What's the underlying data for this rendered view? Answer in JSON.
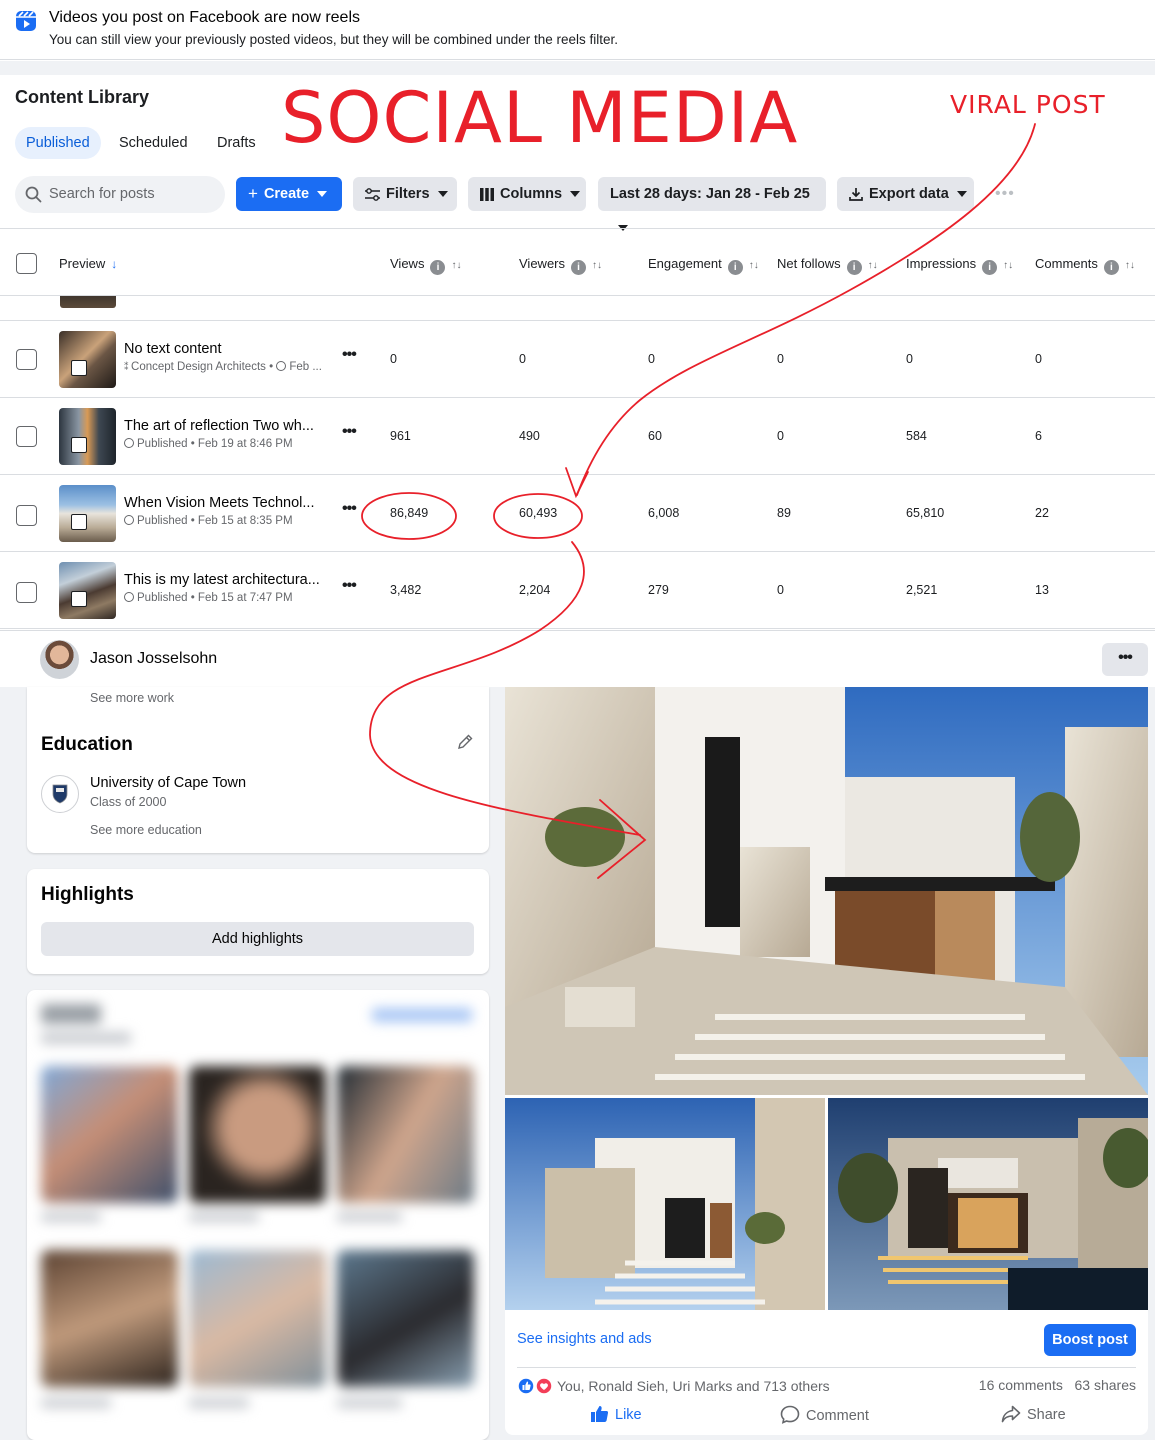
{
  "banner": {
    "title": "Videos you post on Facebook are now reels",
    "subtitle": "You can still view your previously posted videos, but they will be combined under the reels filter.",
    "icon": "reels-icon"
  },
  "library": {
    "title": "Content Library",
    "tabs": [
      {
        "label": "Published",
        "active": true
      },
      {
        "label": "Scheduled",
        "active": false
      },
      {
        "label": "Drafts",
        "active": false
      }
    ],
    "search_placeholder": "Search for posts",
    "buttons": {
      "create": "Create",
      "filters": "Filters",
      "columns": "Columns",
      "date_range": "Last 28 days: Jan 28 - Feb 25",
      "export": "Export data"
    },
    "columns": [
      "Preview",
      "Views",
      "Viewers",
      "Engagement",
      "Net follows",
      "Impressions",
      "Comments"
    ],
    "rows": [
      {
        "title": "No text content",
        "meta": "Concept Design Architects • ",
        "meta_tail": "Feb ...",
        "views": "0",
        "viewers": "0",
        "engagement": "0",
        "net_follows": "0",
        "impressions": "0",
        "comments": "0"
      },
      {
        "title": "The art of reflection Two wh...",
        "meta": "Published • Feb 19 at 8:46 PM",
        "views": "961",
        "viewers": "490",
        "engagement": "60",
        "net_follows": "0",
        "impressions": "584",
        "comments": "6"
      },
      {
        "title": "When Vision Meets Technol...",
        "meta": "Published • Feb 15 at 8:35 PM",
        "views": "86,849",
        "viewers": "60,493",
        "engagement": "6,008",
        "net_follows": "89",
        "impressions": "65,810",
        "comments": "22"
      },
      {
        "title": "This is my latest architectura...",
        "meta": "Published • Feb 15 at 7:47 PM",
        "views": "3,482",
        "viewers": "2,204",
        "engagement": "279",
        "net_follows": "0",
        "impressions": "2,521",
        "comments": "13"
      }
    ]
  },
  "annotations": {
    "big": "SOCIAL MEDIA",
    "small": "VIRAL POST",
    "color": "#e8202a"
  },
  "profile": {
    "name": "Jason Josselsohn",
    "see_more_work": "See more work",
    "education": {
      "title": "Education",
      "school": "University of Cape Town",
      "class": "Class of 2000",
      "see_more": "See more education"
    },
    "highlights": {
      "title": "Highlights",
      "add_label": "Add highlights"
    }
  },
  "post": {
    "insights_link": "See insights and ads",
    "boost_label": "Boost post",
    "reactions_text": "You, Ronald Sieh, Uri Marks and 713 others",
    "comments_count": "16 comments",
    "shares_count": "63 shares",
    "actions": {
      "like": "Like",
      "comment": "Comment",
      "share": "Share"
    }
  },
  "colors": {
    "accent": "#1b6df3",
    "page_bg": "#f0f2f5",
    "tab_active_bg": "#e7f0fd",
    "annotation_red": "#e8202a"
  }
}
